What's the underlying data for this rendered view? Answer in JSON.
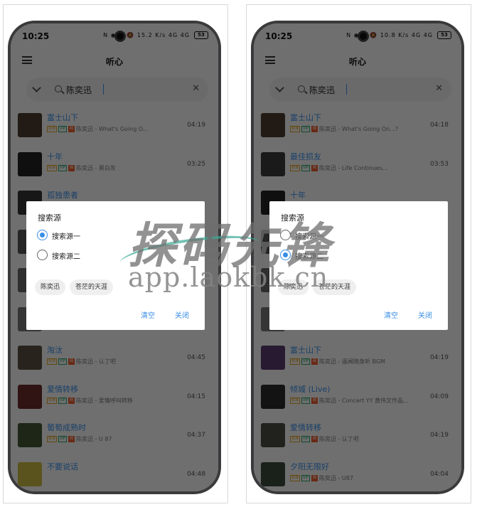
{
  "watermark": {
    "title": "探码先锋",
    "url": "app.laokbk.cn"
  },
  "left": {
    "status": {
      "time": "10:25",
      "icons": "N ◉ ✱ 🔕 15.2 K/s 4G 4G",
      "battery": "53"
    },
    "app_title": "听心",
    "search_query": "陈奕迅",
    "songs": [
      {
        "title": "富士山下",
        "artist_album": "陈奕迅 - What's Going O...",
        "duration": "04:19",
        "cover": "#4a3a30"
      },
      {
        "title": "十年",
        "artist_album": "陈奕迅 - 黑白灰",
        "duration": "03:25",
        "cover": "#222222"
      },
      {
        "title": "孤独患者",
        "artist_album": "",
        "duration": "",
        "cover": "#333333"
      },
      {
        "title": "",
        "artist_album": "",
        "duration": "",
        "cover": "#555555"
      },
      {
        "title": "",
        "artist_album": "",
        "duration": "",
        "cover": "#666666"
      },
      {
        "title": "",
        "artist_album": "",
        "duration": "",
        "cover": "#777777"
      },
      {
        "title": "淘汰",
        "artist_album": "陈奕迅 - 认了吧",
        "duration": "04:45",
        "cover": "#5a5040"
      },
      {
        "title": "爱情转移",
        "artist_album": "陈奕迅 - 爱情呼叫转移",
        "duration": "04:15",
        "cover": "#6a2a2a"
      },
      {
        "title": "葡萄成熟时",
        "artist_album": "陈奕迅 - U 87",
        "duration": "04:37",
        "cover": "#445533"
      },
      {
        "title": "不要说话",
        "artist_album": "",
        "duration": "04:48",
        "cover": "#c8b840"
      }
    ],
    "dialog": {
      "title": "搜索源",
      "options": [
        {
          "label": "搜索源一",
          "selected": true
        },
        {
          "label": "搜索源二",
          "selected": false
        }
      ],
      "history": [
        "陈奕迅",
        "苍茫的天涯"
      ],
      "clear_label": "清空",
      "close_label": "关闭"
    }
  },
  "right": {
    "status": {
      "time": "10:25",
      "icons": "N ◉ ✱ 🔕 10.8 K/s 4G 4G",
      "battery": "53"
    },
    "app_title": "听心",
    "search_query": "陈奕迅",
    "songs": [
      {
        "title": "富士山下",
        "artist_album": "陈奕迅 - What's Going On...?",
        "duration": "04:18",
        "cover": "#4a3a30"
      },
      {
        "title": "最佳损友",
        "artist_album": "陈奕迅 - Life Continues...",
        "duration": "03:53",
        "cover": "#3a3a3a"
      },
      {
        "title": "十年",
        "artist_album": "",
        "duration": "",
        "cover": "#222222"
      },
      {
        "title": "",
        "artist_album": "",
        "duration": "",
        "cover": "#555555"
      },
      {
        "title": "",
        "artist_album": "",
        "duration": "",
        "cover": "#666666"
      },
      {
        "title": "",
        "artist_album": "",
        "duration": "",
        "cover": "#777777"
      },
      {
        "title": "富士山下",
        "artist_album": "陈奕迅 - 遥闻随身听 BGM",
        "duration": "04:19",
        "cover": "#5a3a6a"
      },
      {
        "title": "倾城 (Live)",
        "artist_album": "陈奕迅 - Concert YY 黄伟文作品...",
        "duration": "04:09",
        "cover": "#2a2a2a"
      },
      {
        "title": "爱情转移",
        "artist_album": "陈奕迅 - 认了吧",
        "duration": "04:19",
        "cover": "#4a4a40"
      },
      {
        "title": "夕阳无限好",
        "artist_album": "陈奕迅 - U87",
        "duration": "04:04",
        "cover": "#3a4a3a"
      }
    ],
    "dialog": {
      "title": "搜索源",
      "options": [
        {
          "label": "搜索源一",
          "selected": false
        },
        {
          "label": "搜索源二",
          "selected": true
        }
      ],
      "history": [
        "陈奕迅",
        "苍茫的天涯"
      ],
      "clear_label": "清空",
      "close_label": "关闭"
    }
  }
}
